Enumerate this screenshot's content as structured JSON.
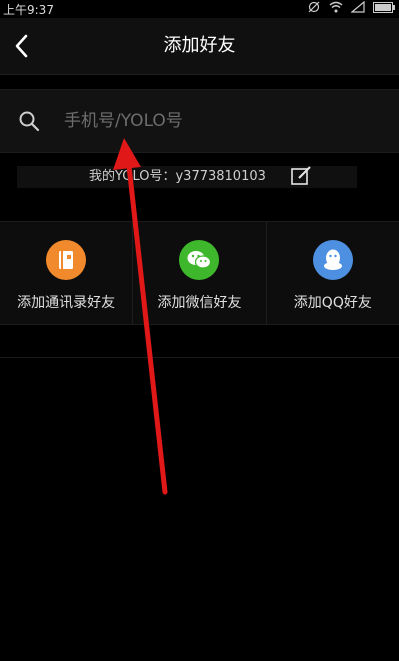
{
  "status_bar": {
    "time": "上午9:37"
  },
  "header": {
    "title": "添加好友"
  },
  "search": {
    "placeholder": "手机号/YOLO号"
  },
  "profile": {
    "yolo_id_text": "我的YOLO号：y3773810103"
  },
  "options": [
    {
      "label": "添加通讯录好友",
      "icon": "contacts-book-icon",
      "color": "#f08a2c"
    },
    {
      "label": "添加微信好友",
      "icon": "wechat-icon",
      "color": "#3fb72c"
    },
    {
      "label": "添加QQ好友",
      "icon": "qq-penguin-icon",
      "color": "#4d8fe0"
    }
  ],
  "colors": {
    "arrow": "#e01818",
    "background": "#000000"
  }
}
